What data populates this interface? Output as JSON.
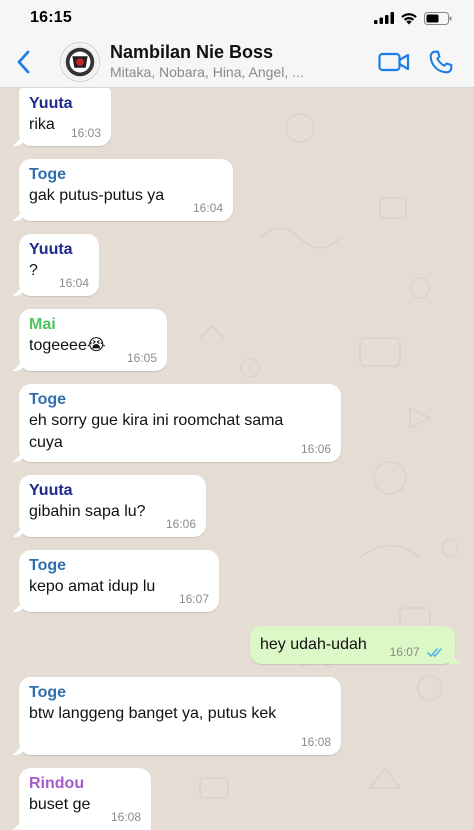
{
  "status_bar": {
    "time": "16:15"
  },
  "header": {
    "back_icon": "chevron-left-icon",
    "group_name": "Nambilan Nie Boss",
    "members": "Mitaka, Nobara, Hina, Angel, ...",
    "video_icon": "video-call-icon",
    "phone_icon": "phone-icon",
    "accent": "#1a7ee6"
  },
  "messages": [
    {
      "direction": "in",
      "sender": "Yuuta",
      "sender_color": "#1e2a8c",
      "text": "rika",
      "time": "16:03"
    },
    {
      "direction": "in",
      "sender": "Toge",
      "sender_color": "#2f6fae",
      "text": "gak putus-putus ya",
      "time": "16:04"
    },
    {
      "direction": "in",
      "sender": "Yuuta",
      "sender_color": "#1e2a8c",
      "text": "?",
      "time": "16:04"
    },
    {
      "direction": "in",
      "sender": "Mai",
      "sender_color": "#4fc35a",
      "text": "togeeee😭",
      "time": "16:05"
    },
    {
      "direction": "in",
      "sender": "Toge",
      "sender_color": "#2f6fae",
      "text": "eh sorry gue kira ini roomchat sama cuya",
      "time": "16:06"
    },
    {
      "direction": "in",
      "sender": "Yuuta",
      "sender_color": "#1e2a8c",
      "text": "gibahin sapa lu?",
      "time": "16:06"
    },
    {
      "direction": "in",
      "sender": "Toge",
      "sender_color": "#2f6fae",
      "text": "kepo amat idup lu",
      "time": "16:07"
    },
    {
      "direction": "out",
      "sender": "",
      "sender_color": "",
      "text": "hey udah-udah",
      "time": "16:07"
    },
    {
      "direction": "in",
      "sender": "Toge",
      "sender_color": "#2f6fae",
      "text": "btw langgeng banget ya, putus kek",
      "time": "16:08"
    },
    {
      "direction": "in",
      "sender": "Rindou",
      "sender_color": "#a45bc9",
      "text": "buset ge",
      "time": "16:08"
    }
  ]
}
